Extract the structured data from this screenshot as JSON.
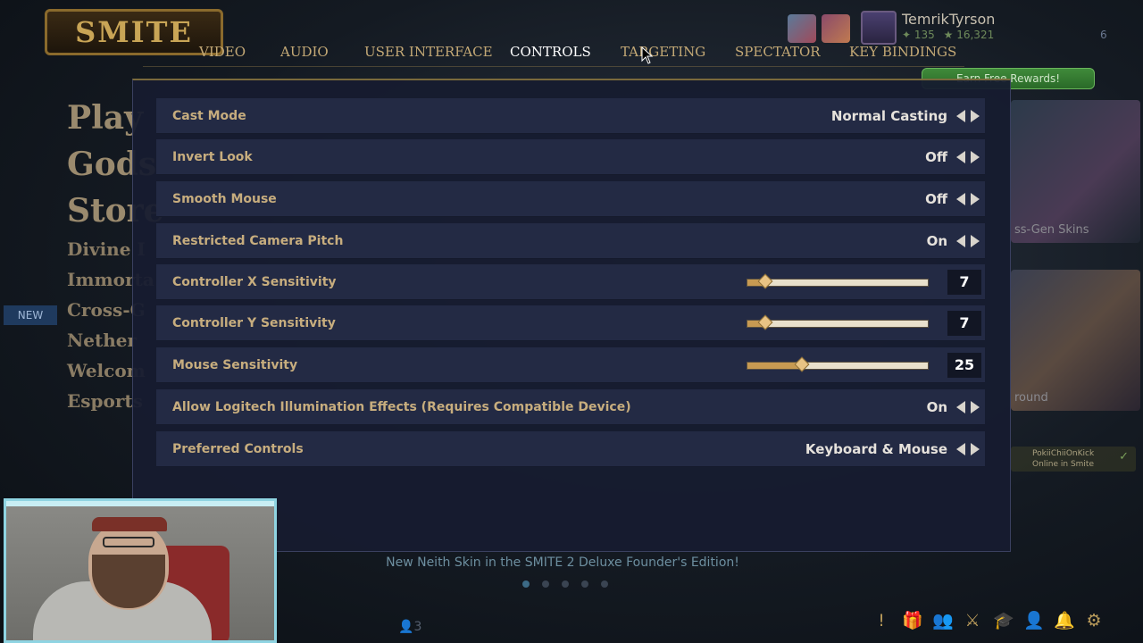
{
  "background": {
    "logo": "SMITE",
    "nav_big": [
      "Play",
      "Gods",
      "Store"
    ],
    "nav_small": [
      "Divine I",
      "Immorta",
      "Cross-G",
      "Nether",
      "Welcom",
      "Esports"
    ],
    "new_tag": "NEW",
    "profile": {
      "username": "TemrikTyrson",
      "stat_1": "135",
      "stat_2": "16,321",
      "level": "6"
    },
    "rewards_button": "Earn Free Rewards!",
    "side_label_1": "ss-Gen Skins",
    "side_label_2": "round",
    "friend": {
      "name": "PokiiChiiOnKick",
      "status": "Online in Smite"
    },
    "news_banner": "New Neith Skin in the SMITE 2 Deluxe Founder's Edition!",
    "party_count": "3"
  },
  "tabs": [
    {
      "label": "VIDEO"
    },
    {
      "label": "AUDIO"
    },
    {
      "label": "USER INTERFACE"
    },
    {
      "label": "CONTROLS",
      "active": true
    },
    {
      "label": "TARGETING"
    },
    {
      "label": "SPECTATOR"
    },
    {
      "label": "KEY BINDINGS"
    }
  ],
  "settings": {
    "cast_mode": {
      "label": "Cast Mode",
      "value": "Normal Casting"
    },
    "invert_look": {
      "label": "Invert Look",
      "value": "Off"
    },
    "smooth_mouse": {
      "label": "Smooth Mouse",
      "value": "Off"
    },
    "restricted_camera_pitch": {
      "label": "Restricted Camera Pitch",
      "value": "On"
    },
    "controller_x_sensitivity": {
      "label": "Controller X Sensitivity",
      "value": "7",
      "level": 0.1
    },
    "controller_y_sensitivity": {
      "label": "Controller Y Sensitivity",
      "value": "7",
      "level": 0.1
    },
    "mouse_sensitivity": {
      "label": "Mouse Sensitivity",
      "value": "25",
      "level": 0.3
    },
    "logitech_illumination": {
      "label": "Allow Logitech Illumination Effects (Requires Compatible Device)",
      "value": "On"
    },
    "preferred_controls": {
      "label": "Preferred Controls",
      "value": "Keyboard & Mouse"
    }
  },
  "colors": {
    "accent_gold": "#c7ad7e",
    "tab_active": "#ffffff",
    "panel_bg": "#161c30",
    "slider_fill": "#c79a52"
  },
  "icons": [
    "arrow-left-icon",
    "arrow-right-icon",
    "cursor-icon",
    "alert-icon",
    "gift-icon",
    "friends-icon",
    "crossed-swords-icon",
    "graduation-cap-icon",
    "person-icon",
    "bell-icon",
    "gear-icon"
  ]
}
